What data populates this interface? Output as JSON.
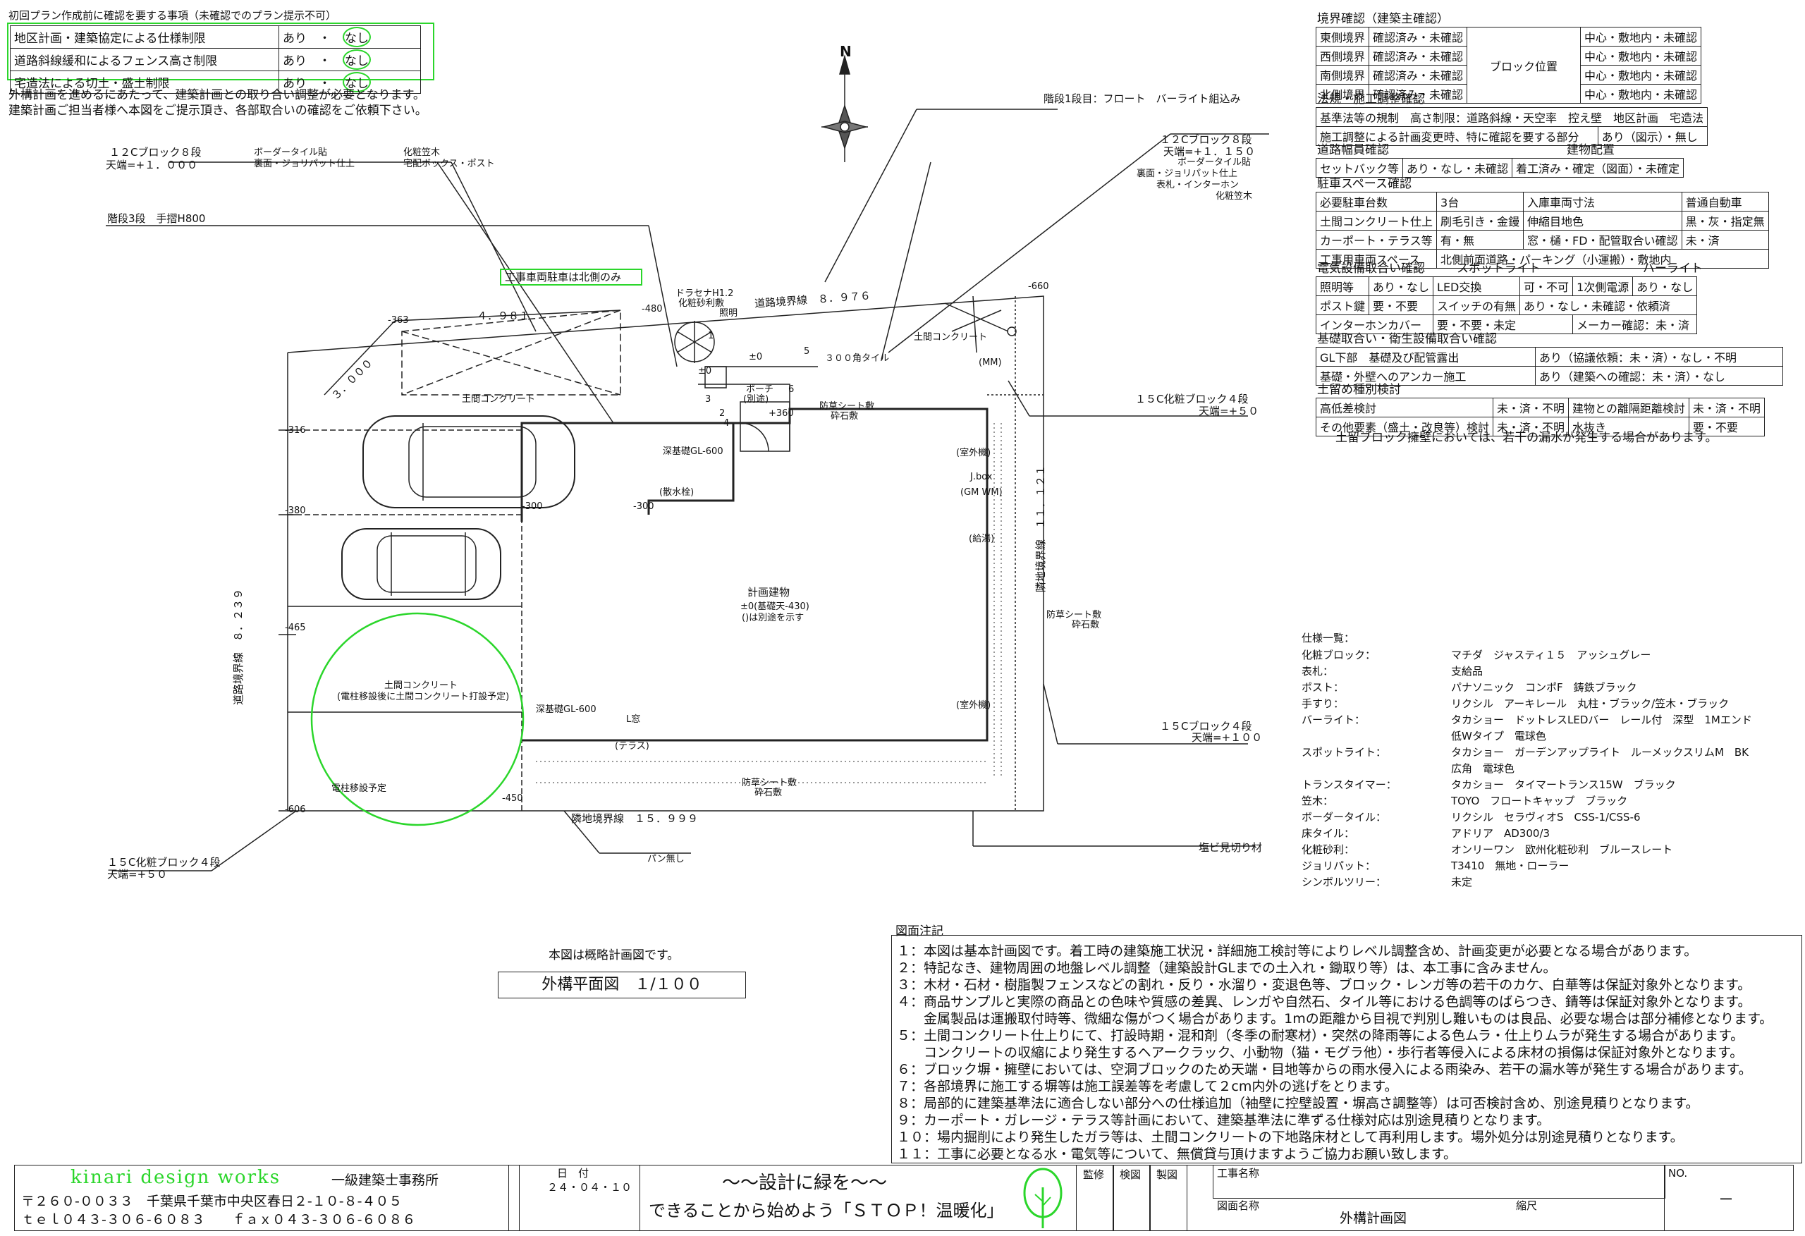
{
  "checklist": {
    "title": "初回プラン作成前に確認を要する事項（未確認でのプラン提示不可）",
    "rows": [
      {
        "label": "地区計画・建築協定による仕様制限",
        "a": "あり",
        "sep": "・",
        "b": "なし"
      },
      {
        "label": "道路斜線緩和によるフェンス高さ制限",
        "a": "あり",
        "sep": "・",
        "b": "なし"
      },
      {
        "label": "宅造法による切土・盛土制限",
        "a": "あり",
        "sep": "・",
        "b": "なし"
      }
    ],
    "note1": "外構計画を進めるにあたって、建築計画との取り合い調整が必要となります。",
    "note2": "建築計画ご担当者様へ本図をご提示頂き、各部取合いの確認をご依頼下さい。"
  },
  "right": {
    "boundary_title": "境界確認（建築主確認）",
    "boundary_rows": [
      {
        "label": "東側境界",
        "status": "確認済み・未確認",
        "pos": "中心・敷地内・未確認"
      },
      {
        "label": "西側境界",
        "status": "確認済み・未確認",
        "pos": "中心・敷地内・未確認"
      },
      {
        "label": "南側境界",
        "status": "確認済み・未確認",
        "pos": "中心・敷地内・未確認"
      },
      {
        "label": "北側境界",
        "status": "確認済み・未確認",
        "pos": "中心・敷地内・未確認"
      }
    ],
    "block_pos": "ブロック位置",
    "law_title": "法規・施工調整確認",
    "law_row1": "基準法等の規制　高さ制限：道路斜線・天空率　控え壁　地区計画　宅造法",
    "law_row2a": "施工調整による計画変更時、特に確認を要する部分",
    "law_row2b": "あり（図示）・無し",
    "road_title": "道路幅員確認",
    "bldg_title": "建物配置",
    "road_row_a": "セットバック等",
    "road_row_b": "あり・なし・未確認",
    "road_row_c": "着工済み・確定（図面）・未確定",
    "parking_title": "駐車スペース確認",
    "parking_rows": [
      {
        "a": "必要駐車台数",
        "b": "3台",
        "c": "入庫車両寸法",
        "d": "普通自動車"
      },
      {
        "a": "土間コンクリート仕上",
        "b": "刷毛引き・金鏝",
        "c": "伸縮目地色",
        "d": "黒・灰・指定無"
      },
      {
        "a": "カーポート・テラス等",
        "b": "有・無",
        "c": "窓・樋・FD・配管取合い確認",
        "d": "未・済"
      },
      {
        "a": "工事用車両スペース",
        "b": "北側前面道路・パーキング（小運搬）・敷地内",
        "c": "",
        "d": ""
      }
    ],
    "elec_title": "電気設備取合い確認",
    "spot_title": "スポットライト",
    "par_title": "バーライト",
    "elec_rows": [
      {
        "a": "照明等",
        "b": "あり・なし",
        "c": "LED交換",
        "d": "可・不可",
        "e": "1次側電源",
        "f": "あり・なし"
      },
      {
        "a": "ポスト鍵",
        "b": "要・不要",
        "c": "スイッチの有無",
        "d": "あり・なし・未確認・依頼済",
        "e": "",
        "f": ""
      },
      {
        "a": "インターホンカバー",
        "b": "",
        "c": "要・不要・未定",
        "d": "",
        "e": "メーカー確認：未・済",
        "f": ""
      }
    ],
    "base_title": "基礎取合い・衛生設備取合い確認",
    "base_rows": [
      {
        "a": "GL下部　基礎及び配管露出",
        "b": "あり（協議依頼：未・済）・なし・不明"
      },
      {
        "a": "基礎・外壁へのアンカー施工",
        "b": "あり（建築への確認：未・済）・なし"
      }
    ],
    "ret_title": "土留め種別検討",
    "ret_rows": [
      {
        "a": "高低差検討",
        "b": "未・済・不明",
        "c": "建物との離隔距離検討",
        "d": "未・済・不明"
      },
      {
        "a": "その他要素（盛土・改良等）検討",
        "b": "未・済・不明",
        "c": "水抜き",
        "d": "要・不要"
      }
    ],
    "ret_note": "土留ブロック擁壁においては、若干の漏水が発生する場合があります。"
  },
  "spec": {
    "title": "仕様一覧：",
    "items": [
      {
        "k": "化粧ブロック：",
        "v": "マチダ　ジャスティ１５　アッシュグレー"
      },
      {
        "k": "表札：",
        "v": "支給品"
      },
      {
        "k": "ポスト：",
        "v": "パナソニック　コンポF　鋳鉄ブラック"
      },
      {
        "k": "手すり：",
        "v": "リクシル　アーキレール　丸柱・ブラック/笠木・ブラック"
      },
      {
        "k": "バーライト：",
        "v": "タカショー　ドットレスLEDバー　レール付　深型　1Mエンド"
      },
      {
        "k": "",
        "v": "低Wタイプ　電球色"
      },
      {
        "k": "スポットライト：",
        "v": "タカショー　ガーデンアップライト　ルーメックスリムM　BK"
      },
      {
        "k": "",
        "v": "広角　電球色"
      },
      {
        "k": "トランスタイマー：",
        "v": "タカショー　タイマートランス15W　ブラック"
      },
      {
        "k": "笠木：",
        "v": "TOYO　フロートキャップ　ブラック"
      },
      {
        "k": "ボーダータイル：",
        "v": "リクシル　セラヴィオS　CSS-1/CSS-6"
      },
      {
        "k": "床タイル：",
        "v": "アドリア　AD300/3"
      },
      {
        "k": "化粧砂利：",
        "v": "オンリーワン　欧州化粧砂利　ブルースレート"
      },
      {
        "k": "ジョリパット：",
        "v": "T3410　無地・ローラー"
      },
      {
        "k": "シンボルツリー：",
        "v": "未定"
      }
    ]
  },
  "plan": {
    "north": "N",
    "labels": {
      "block8_left": "１２Cブロック８段",
      "top_left": "天端=+１．０００",
      "border_tile": "ボーダータイル貼",
      "border_tile2": "裏面・ジョリパット仕上",
      "cap": "化粧笠木",
      "cap2": "宅配ボックス・ポスト",
      "stairs": "階段3段　手摺H800",
      "step1": "階段1段目：フロート　バーライト組込み",
      "block8_right": "１２Cブロック８段",
      "top_right": "天端=+１．１５０",
      "border_tile_r": "ボーダータイル貼",
      "jolly_r": "裏面・ジョリパット仕上",
      "intercom": "表札・インターホン",
      "cap_r": "化粧笠木",
      "truck_north": "工事車両駐車は北側のみ",
      "road_line": "道路境界線　８．９７６",
      "dracaena": "ドラセナH1.2",
      "gravel": "化粧砂利敷",
      "light": "照明",
      "tile300": "３００角タイル",
      "conc_top": "土間コンクリート",
      "conc_left": "土間コンクリート",
      "block15_r": "１５C化粧ブロック４段",
      "top50_r": "天端=+５０",
      "porch": "ポーチ",
      "porch2": "(別途)",
      "sheet1": "防草シート敷",
      "gravel1": "砕石敷",
      "deep_gl": "深基礎GL-600",
      "drain": "(散水栓)",
      "outdoor1": "(室外機)",
      "jbox": "J.box",
      "gm": "(GM WM)",
      "hotwater": "(給湯)",
      "bldg": "計画建物",
      "bldg2": "±0(基礎天-430)",
      "bldg3": "()は別途を示す",
      "sheet2": "防草シート敷",
      "gravel2": "砕石敷",
      "outdoor2": "(室外機)",
      "block15b": "１５Cブロック４段",
      "top100": "天端=+１００",
      "deep_gl2": "深基礎GL-600",
      "lwin": "L窓",
      "terrace": "(テラス)",
      "sheet3": "防草シート敷",
      "gravel3": "砕石敷",
      "neighbor": "隣地境界線　１５．９９９",
      "pan": "パン無し",
      "pvc": "塩ビ見切り材",
      "conc_circle": "土間コンクリート",
      "conc_circle2": "(電柱移設後に土間コンクリート打設予定)",
      "pole": "電柱移設予定",
      "road_left": "道路境界線　８．２３９",
      "road_right": "隣地境界線　１１．１２１",
      "block15_l": "１５C化粧ブロック４段",
      "top50_l": "天端=+５０",
      "dim_4981": "４．９８１",
      "dim_3000": "３．０００",
      "l363": "-363",
      "l316": "-316",
      "l380": "-380",
      "l465": "-465",
      "l606": "-606",
      "l450": "-450",
      "l300a": "-300",
      "l300b": "-300",
      "l480": "-480",
      "l660": "-660",
      "lpm0a": "±0",
      "lpm0b": "±0",
      "l360": "+360",
      "mm": "(MM)"
    },
    "circled": [
      "1",
      "2",
      "3",
      "4",
      "5",
      "6"
    ]
  },
  "caption": {
    "line1": "本図は概略計画図です。",
    "line2": "外構平面図　１/１００"
  },
  "notes": {
    "title": "図面注記",
    "lines": [
      "１：本図は基本計画図です。着工時の建築施工状況・詳細施工検討等によりレベル調整含め、計画変更が必要となる場合があります。",
      "２：特記なき、建物周囲の地盤レベル調整（建築設計GLまでの土入れ・鋤取り等）は、本工事に含みません。",
      "３：木材・石材・樹脂製フェンスなどの割れ・反り・水溜り・変退色等、ブロック・レンガ等の若干のカケ、白華等は保証対象外となります。",
      "４：商品サンプルと実際の商品との色味や質感の差異、レンガや自然石、タイル等における色調等のばらつき、錆等は保証対象外となります。",
      "　　金属製品は運搬取付時等、微細な傷がつく場合があります。1mの距離から目視で判別し難いものは良品、必要な場合は部分補修となります。",
      "５：土間コンクリート仕上りにて、打設時期・混和剤（冬季の耐寒材）・突然の降雨等による色ムラ・仕上りムラが発生する場合があります。",
      "　　コンクリートの収縮により発生するヘアークラック、小動物（猫・モグラ他）・歩行者等侵入による床材の損傷は保証対象外となります。",
      "６：ブロック塀・擁壁においては、空洞ブロックのため天端・目地等からの雨水侵入による雨染み、若干の漏水等が発生する場合があります。",
      "７：各部境界に施工する塀等は施工誤差等を考慮して２cm内外の逃げをとります。",
      "８：局部的に建築基準法に適合しない部分への仕様追加（袖壁に控壁設置・塀高さ調整等）は可否検討含め、別途見積りとなります。",
      "９：カーポート・ガレージ・テラス等計画において、建築基準法に準ずる仕様対応は別途見積りとなります。",
      "１０：場内掘削により発生したガラ等は、土間コンクリートの下地路床材として再利用します。場外処分は別途見積りとなります。",
      "１１：工事に必要となる水・電気等について、無償貸与頂けますようご協力お願い致します。"
    ]
  },
  "titleblock": {
    "company": "kinari design works",
    "office": "一級建築士事務所",
    "address": "〒２６０-００３３　千葉県千葉市中央区春日２-１０-８-４０５",
    "tel": "ｔｅｌ０４３-３０６-６０８３　　ｆａｘ０４３-３０６-６０８６",
    "date_label": "日　付",
    "date": "２４・０４・１０",
    "slogan1": "～～設計に緑を～～",
    "slogan2": "できることから始めよう「ＳＴＯＰ！温暖化」",
    "kanshu": "監修",
    "kennin": "検図",
    "seizu": "製図",
    "project": "工事名称",
    "drawing_name_label": "図面名称",
    "drawing_name": "外構計画図",
    "scale_label": "縮尺",
    "no_label": "NO.",
    "no_value": "ー"
  },
  "colors": {
    "accent": "#2bd62b",
    "line": "#222222"
  }
}
